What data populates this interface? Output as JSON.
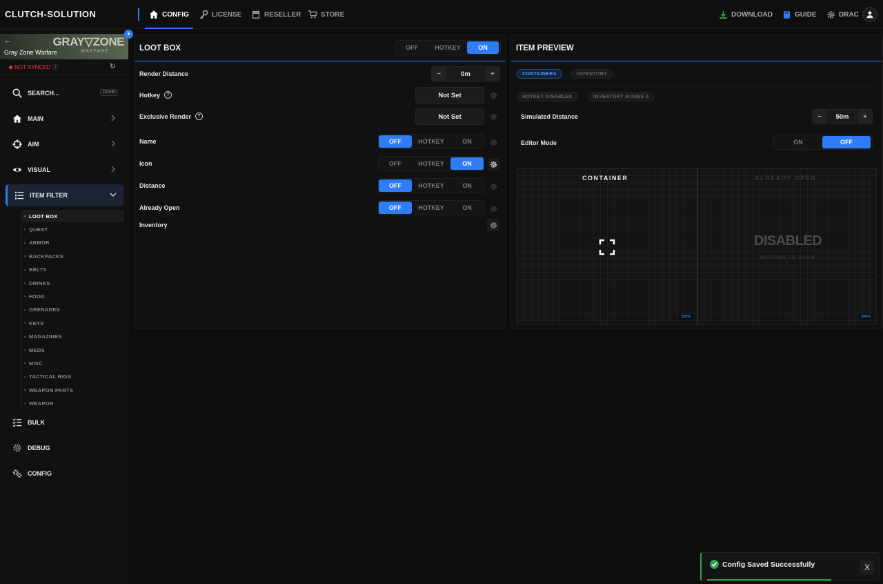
{
  "app": {
    "brand": "CLUTCH-SOLUTION"
  },
  "nav": {
    "tabs": [
      {
        "label": "CONFIG",
        "icon": "home-icon",
        "active": true
      },
      {
        "label": "LICENSE",
        "icon": "key-icon"
      },
      {
        "label": "RESELLER",
        "icon": "store-icon"
      },
      {
        "label": "STORE",
        "icon": "cart-icon"
      }
    ],
    "right": [
      {
        "label": "DOWNLOAD",
        "icon": "download-icon"
      },
      {
        "label": "GUIDE",
        "icon": "book-icon"
      },
      {
        "label": "DRAC",
        "icon": "gear-icon"
      }
    ]
  },
  "sidebar": {
    "game": {
      "name": "Gray Zone Warfare",
      "logo_main": "GRAY▽ZONE",
      "logo_sub": "WARFARE"
    },
    "sync_status": "NOT SYNCED",
    "search": {
      "label": "SEARCH...",
      "shortcut": "Ctrl+K"
    },
    "items": [
      {
        "label": "MAIN",
        "icon": "home-icon"
      },
      {
        "label": "AIM",
        "icon": "crosshair-icon"
      },
      {
        "label": "VISUAL",
        "icon": "eye-icon"
      },
      {
        "label": "ITEM FILTER",
        "icon": "list-icon",
        "active": true
      }
    ],
    "subitems": [
      "LOOT BOX",
      "QUEST",
      "ARMOR",
      "BACKPACKS",
      "BELTS",
      "DRINKS",
      "FOOD",
      "GRENADES",
      "KEYS",
      "MAGAZINES",
      "MEDS",
      "MISC",
      "TACTICAL RIGS",
      "WEAPON PARTS",
      "WEAPON"
    ],
    "active_subitem": "LOOT BOX",
    "bottom_items": [
      {
        "label": "BULK",
        "icon": "checklist-icon"
      },
      {
        "label": "DEBUG",
        "icon": "gear-icon"
      },
      {
        "label": "CONFIG",
        "icon": "gears-icon"
      }
    ]
  },
  "loot_box": {
    "title": "LOOT BOX",
    "mode": {
      "options": [
        "OFF",
        "HOTKEY",
        "ON"
      ],
      "selected": "ON"
    },
    "render_distance": {
      "label": "Render Distance",
      "value": "0m",
      "minus": "−",
      "plus": "+"
    },
    "hotkey": {
      "label": "Hotkey",
      "value": "Not Set"
    },
    "exclusive_render": {
      "label": "Exclusive Render",
      "value": "Not Set"
    },
    "rows": [
      {
        "label": "Name",
        "options": [
          "OFF",
          "HOTKEY",
          "ON"
        ],
        "selected": "OFF"
      },
      {
        "label": "Icon",
        "options": [
          "OFF",
          "HOTKEY",
          "ON"
        ],
        "selected": "ON"
      },
      {
        "label": "Distance",
        "options": [
          "OFF",
          "HOTKEY",
          "ON"
        ],
        "selected": "OFF"
      },
      {
        "label": "Already Open",
        "options": [
          "OFF",
          "HOTKEY",
          "ON"
        ],
        "selected": "OFF"
      }
    ],
    "inventory": {
      "label": "Inventory"
    }
  },
  "item_preview": {
    "title": "ITEM PREVIEW",
    "tabs": [
      {
        "label": "CONTAINERS",
        "active": true
      },
      {
        "label": "INVENTORY"
      }
    ],
    "chips": [
      "HOTKEY DISABLED",
      "INVENTORY MOUSE 4"
    ],
    "simulated_distance": {
      "label": "Simulated Distance",
      "value": "50m",
      "minus": "−",
      "plus": "+"
    },
    "editor_mode": {
      "label": "Editor Mode",
      "options": [
        "ON",
        "OFF"
      ],
      "selected": "OFF"
    },
    "left_heading": "CONTAINER",
    "right_heading": "ALREADY OPEN",
    "disabled_text": "DISABLED",
    "disabled_sub": "NOTHING TO SHOW",
    "zoom_left": "200%",
    "zoom_right": "200%"
  },
  "toast": {
    "message": "Config Saved Successfully",
    "close": "X"
  },
  "colors": {
    "accent": "#2e7cf6",
    "success": "#2ea24a",
    "error": "#e23b3b",
    "background": "#0d0d0d"
  }
}
